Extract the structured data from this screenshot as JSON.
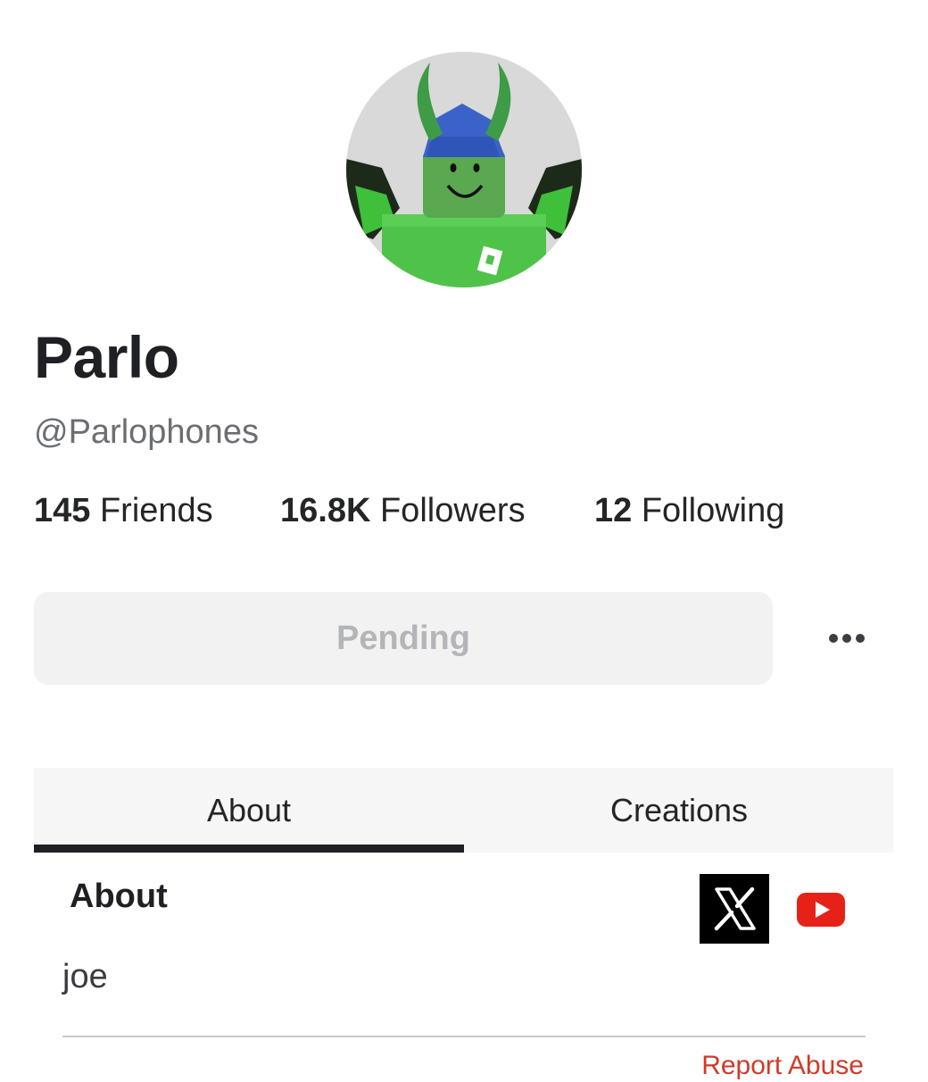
{
  "profile": {
    "display_name": "Parlo",
    "username": "@Parlophones",
    "avatar_icon": "avatar-image"
  },
  "stats": {
    "friends": {
      "value": "145",
      "label": "Friends"
    },
    "followers": {
      "value": "16.8K",
      "label": "Followers"
    },
    "following": {
      "value": "12",
      "label": "Following"
    }
  },
  "actions": {
    "pending_label": "Pending",
    "more_icon": "more-horizontal-icon"
  },
  "tabs": [
    {
      "label": "About",
      "active": true
    },
    {
      "label": "Creations",
      "active": false
    }
  ],
  "about": {
    "heading": "About",
    "description": "joe",
    "social_links": [
      {
        "icon": "x-twitter-icon"
      },
      {
        "icon": "youtube-icon"
      }
    ],
    "report_label": "Report Abuse"
  },
  "colors": {
    "text_primary": "#1f2023",
    "text_secondary": "#6b6e72",
    "button_bg": "#f2f2f3",
    "button_text": "#b3b5b8",
    "tab_bg": "#f6f6f6",
    "report_red": "#d23a2a",
    "youtube_red": "#e62117"
  }
}
